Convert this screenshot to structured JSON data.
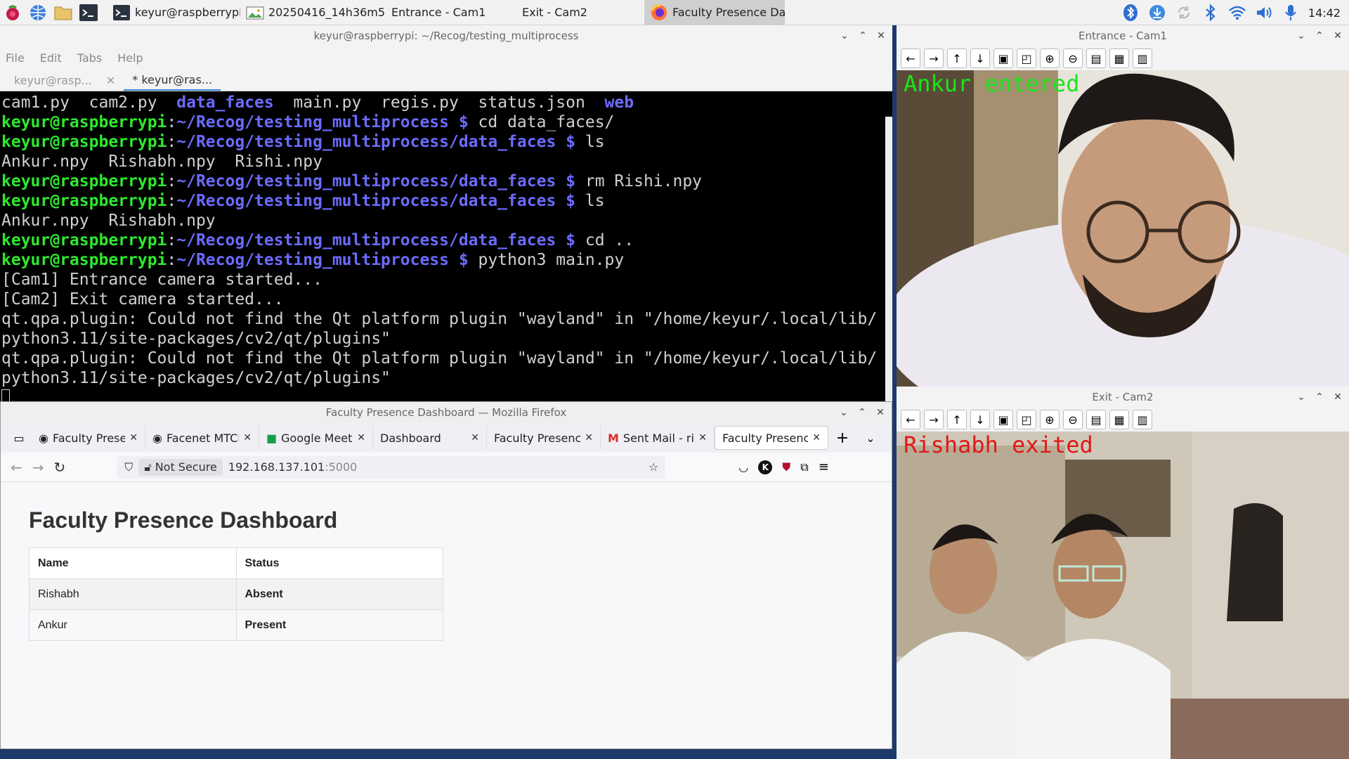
{
  "taskbar": {
    "items": [
      {
        "label": "keyur@raspberrypi: ..."
      },
      {
        "label": "20250416_14h36m5..."
      },
      {
        "label": "Entrance - Cam1"
      },
      {
        "label": "Exit - Cam2"
      },
      {
        "label": "Faculty Presence Da..."
      }
    ],
    "clock": "14:42"
  },
  "terminal": {
    "title": "keyur@raspberrypi: ~/Recog/testing_multiprocess",
    "menu": [
      "File",
      "Edit",
      "Tabs",
      "Help"
    ],
    "tabs": [
      {
        "label": "keyur@rasp..."
      },
      {
        "label": "* keyur@ras..."
      }
    ],
    "lines": [
      [
        {
          "t": "cam1.py  cam2.py  ",
          "c": "w"
        },
        {
          "t": "data_faces",
          "c": "b"
        },
        {
          "t": "  main.py  regis.py  status.json  ",
          "c": "w"
        },
        {
          "t": "web",
          "c": "b"
        }
      ],
      [
        {
          "t": "keyur@raspberrypi",
          "c": "g"
        },
        {
          "t": ":",
          "c": "w"
        },
        {
          "t": "~/Recog/testing_multiprocess $ ",
          "c": "b"
        },
        {
          "t": "cd data_faces/",
          "c": "w"
        }
      ],
      [
        {
          "t": "keyur@raspberrypi",
          "c": "g"
        },
        {
          "t": ":",
          "c": "w"
        },
        {
          "t": "~/Recog/testing_multiprocess/data_faces $ ",
          "c": "b"
        },
        {
          "t": "ls",
          "c": "w"
        }
      ],
      [
        {
          "t": "Ankur.npy  Rishabh.npy  Rishi.npy",
          "c": "w"
        }
      ],
      [
        {
          "t": "keyur@raspberrypi",
          "c": "g"
        },
        {
          "t": ":",
          "c": "w"
        },
        {
          "t": "~/Recog/testing_multiprocess/data_faces $ ",
          "c": "b"
        },
        {
          "t": "rm Rishi.npy",
          "c": "w"
        }
      ],
      [
        {
          "t": "keyur@raspberrypi",
          "c": "g"
        },
        {
          "t": ":",
          "c": "w"
        },
        {
          "t": "~/Recog/testing_multiprocess/data_faces $ ",
          "c": "b"
        },
        {
          "t": "ls",
          "c": "w"
        }
      ],
      [
        {
          "t": "Ankur.npy  Rishabh.npy",
          "c": "w"
        }
      ],
      [
        {
          "t": "keyur@raspberrypi",
          "c": "g"
        },
        {
          "t": ":",
          "c": "w"
        },
        {
          "t": "~/Recog/testing_multiprocess/data_faces $ ",
          "c": "b"
        },
        {
          "t": "cd ..",
          "c": "w"
        }
      ],
      [
        {
          "t": "keyur@raspberrypi",
          "c": "g"
        },
        {
          "t": ":",
          "c": "w"
        },
        {
          "t": "~/Recog/testing_multiprocess $ ",
          "c": "b"
        },
        {
          "t": "python3 main.py",
          "c": "w"
        }
      ],
      [
        {
          "t": "[Cam1] Entrance camera started...",
          "c": "w"
        }
      ],
      [
        {
          "t": "[Cam2] Exit camera started...",
          "c": "w"
        }
      ],
      [
        {
          "t": "qt.qpa.plugin: Could not find the Qt platform plugin \"wayland\" in \"/home/keyur/.local/lib/",
          "c": "w"
        }
      ],
      [
        {
          "t": "python3.11/site-packages/cv2/qt/plugins\"",
          "c": "w"
        }
      ],
      [
        {
          "t": "qt.qpa.plugin: Could not find the Qt platform plugin \"wayland\" in \"/home/keyur/.local/lib/",
          "c": "w"
        }
      ],
      [
        {
          "t": "python3.11/site-packages/cv2/qt/plugins\"",
          "c": "w"
        }
      ]
    ]
  },
  "firefox": {
    "title": "Faculty Presence Dashboard — Mozilla Firefox",
    "tabs": [
      {
        "label": "Faculty Presen"
      },
      {
        "label": "Facenet MTCN"
      },
      {
        "label": "Google Meet"
      },
      {
        "label": "Dashboard"
      },
      {
        "label": "Faculty Presence"
      },
      {
        "label": "Sent Mail - rish"
      },
      {
        "label": "Faculty Presence"
      }
    ],
    "not_secure": "Not Secure",
    "url_host": "192.168.137.101",
    "url_port": ":5000"
  },
  "dashboard": {
    "heading": "Faculty Presence Dashboard",
    "headers": {
      "name": "Name",
      "status": "Status"
    },
    "rows": [
      {
        "name": "Rishabh",
        "status": "Absent"
      },
      {
        "name": "Ankur",
        "status": "Present"
      }
    ]
  },
  "cam1": {
    "title": "Entrance - Cam1",
    "overlay": "Ankur entered",
    "overlay_color": "#19e619"
  },
  "cam2": {
    "title": "Exit - Cam2",
    "overlay": "Rishabh exited",
    "overlay_color": "#e01818"
  },
  "colors": {
    "prompt_user": "#2ee92e",
    "prompt_path": "#6b6bff",
    "absent": "#e01010",
    "present": "#1c8c1c"
  }
}
